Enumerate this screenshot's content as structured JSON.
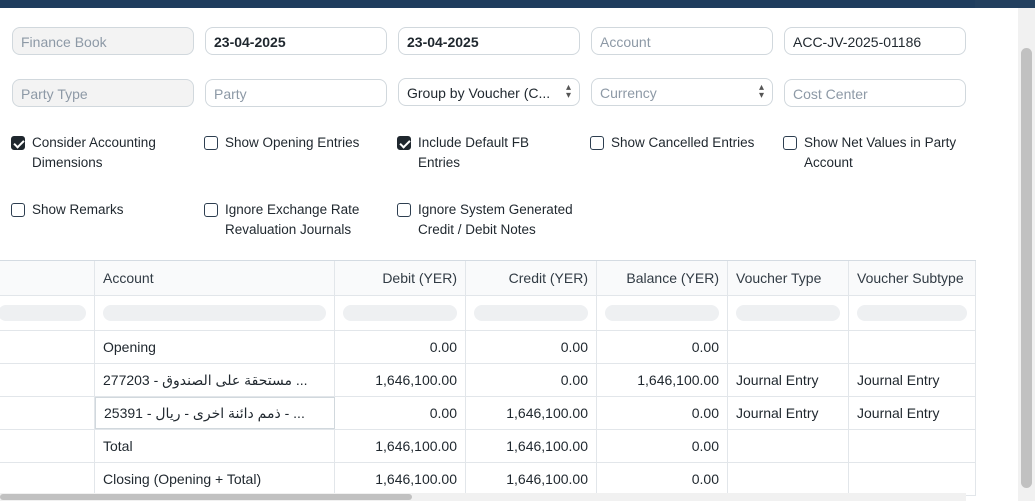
{
  "filters": {
    "finance_book": {
      "placeholder": "Finance Book"
    },
    "from_date": {
      "value": "23-04-2025"
    },
    "to_date": {
      "value": "23-04-2025"
    },
    "account": {
      "placeholder": "Account"
    },
    "voucher_no": {
      "value": "ACC-JV-2025-01186"
    },
    "party_type": {
      "placeholder": "Party Type"
    },
    "party": {
      "placeholder": "Party"
    },
    "group_by": {
      "value": "Group by Voucher (C..."
    },
    "currency": {
      "placeholder": "Currency"
    },
    "cost_center": {
      "placeholder": "Cost Center"
    }
  },
  "checkboxes": [
    {
      "label": "Consider Accounting Dimensions",
      "checked": true
    },
    {
      "label": "Show Opening Entries",
      "checked": false
    },
    {
      "label": "Include Default FB Entries",
      "checked": true
    },
    {
      "label": "Show Cancelled Entries",
      "checked": false
    },
    {
      "label": "Show Net Values in Party Account",
      "checked": false
    },
    {
      "label": "Show Remarks",
      "checked": false
    },
    {
      "label": "Ignore Exchange Rate Revaluation Journals",
      "checked": false
    },
    {
      "label": "Ignore System Generated Credit / Debit Notes",
      "checked": false
    }
  ],
  "table": {
    "columns": [
      "Account",
      "Debit (YER)",
      "Credit (YER)",
      "Balance (YER)",
      "Voucher Type",
      "Voucher Subtype"
    ],
    "rows": [
      {
        "account": "Opening",
        "debit": "0.00",
        "credit": "0.00",
        "balance": "0.00",
        "voucher_type": "",
        "voucher_subtype": ""
      },
      {
        "account": "277203 - مستحقة على الصندوق ...",
        "debit": "1,646,100.00",
        "credit": "0.00",
        "balance": "1,646,100.00",
        "voucher_type": "Journal Entry",
        "voucher_subtype": "Journal Entry"
      },
      {
        "account": "25391 - ذمم دائنة اخرى - ريال - ...",
        "debit": "0.00",
        "credit": "1,646,100.00",
        "balance": "0.00",
        "voucher_type": "Journal Entry",
        "voucher_subtype": "Journal Entry"
      },
      {
        "account": "Total",
        "debit": "1,646,100.00",
        "credit": "1,646,100.00",
        "balance": "0.00",
        "voucher_type": "",
        "voucher_subtype": ""
      },
      {
        "account": "Closing (Opening + Total)",
        "debit": "1,646,100.00",
        "credit": "1,646,100.00",
        "balance": "0.00",
        "voucher_type": "",
        "voucher_subtype": ""
      }
    ]
  }
}
